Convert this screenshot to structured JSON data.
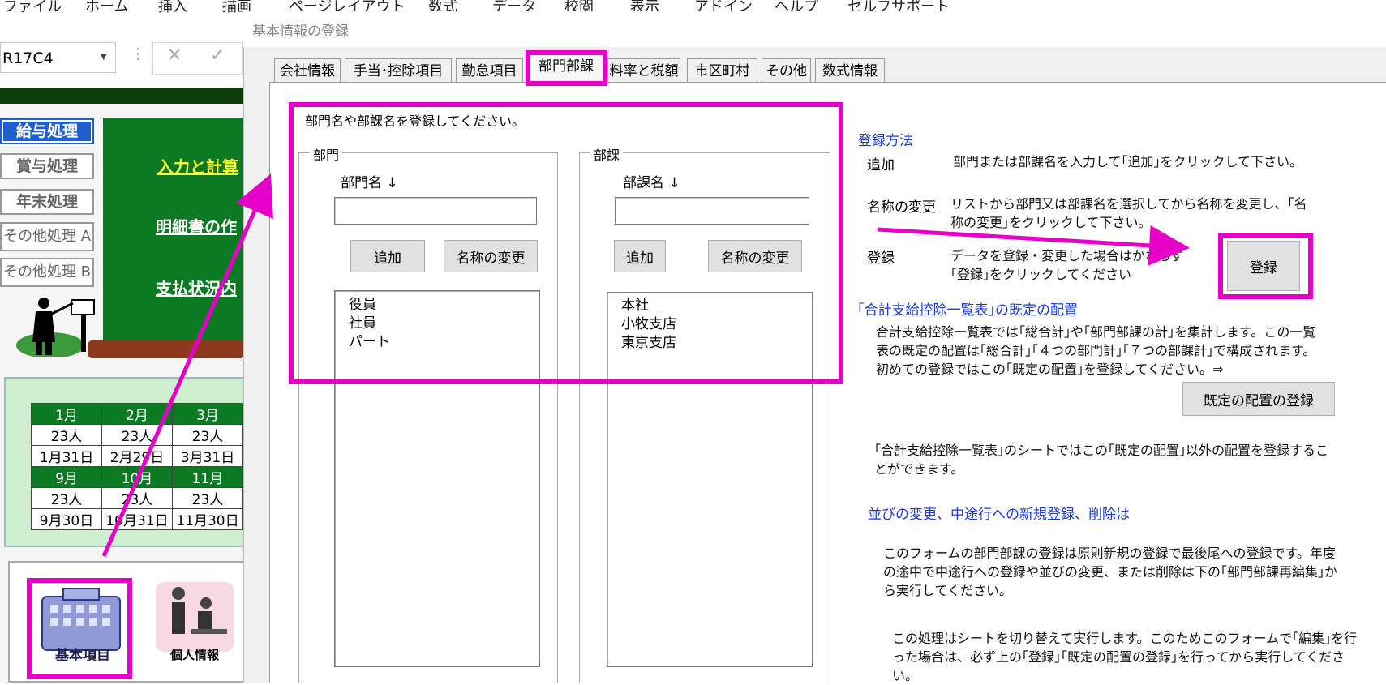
{
  "excel": {
    "menu": [
      "ファイル",
      "ホーム",
      "挿入",
      "描画",
      "ページレイアウト",
      "数式",
      "データ",
      "校閲",
      "表示",
      "アドイン",
      "ヘルプ",
      "セルフサポート"
    ],
    "name_box": "R17C4",
    "side_buttons": [
      "給与処理",
      "賞与処理",
      "年末処理",
      "その他処理 A",
      "その他処理 B"
    ],
    "board_links": [
      "入力と計算",
      "明細書の作",
      "支払状況内"
    ],
    "calendar": {
      "row1_months": [
        "1月",
        "2月",
        "3月"
      ],
      "row1_counts": [
        "23人",
        "23人",
        "23人"
      ],
      "row1_dates": [
        "1月31日",
        "2月29日",
        "3月31日"
      ],
      "row2_months": [
        "9月",
        "10月",
        "11月"
      ],
      "row2_counts": [
        "23人",
        "23人",
        "23人"
      ],
      "row2_dates": [
        "9月30日",
        "10月31日",
        "11月30日"
      ]
    },
    "icons": {
      "kihon_label": "基本項目",
      "kojin_label": "個人情報"
    }
  },
  "dialog": {
    "title": "基本情報の登録",
    "tabs": [
      "会社情報",
      "手当･控除項目",
      "勤怠項目",
      "部門部課",
      "料率と税額",
      "市区町村",
      "その他",
      "数式情報"
    ],
    "active_tab": "部門部課",
    "instruction": "部門名や部課名を登録してください。",
    "dept": {
      "group_caption": "部門",
      "field_label": "部門名 ↓",
      "input_value": "",
      "add_button": "追加",
      "rename_button": "名称の変更",
      "items": [
        "役員",
        "社員",
        "パート"
      ]
    },
    "section": {
      "group_caption": "部課",
      "field_label": "部課名 ↓",
      "input_value": "",
      "add_button": "追加",
      "rename_button": "名称の変更",
      "items": [
        "本社",
        "小牧支店",
        "東京支店"
      ]
    },
    "help": {
      "heading": "登録方法",
      "add_key": "追加",
      "add_text": "部門または部課名を入力して｢追加｣をクリックして下さい。",
      "rename_key": "名称の変更",
      "rename_text": "リストから部門又は部課名を選択してから名称を変更し、｢名称の変更｣をクリックして下さい。",
      "register_key": "登録",
      "register_text": "データを登録・変更した場合はかならず｢登録｣をクリックしてください",
      "register_button": "登録",
      "layout_heading": "｢合計支給控除一覧表｣の既定の配置",
      "layout_text": "合計支給控除一覧表では｢総合計｣や｢部門部課の計｣を集計します。この一覧表の既定の配置は｢総合計｣｢４つの部門計｣｢７つの部課計｣で構成されます。初めての登録ではこの｢既定の配置｣を登録してください。⇒",
      "default_layout_button": "既定の配置の登録",
      "other_layout_text": "｢合計支給控除一覧表｣のシートではこの｢既定の配置｣以外の配置を登録することができます。",
      "reorder_heading": "並びの変更、中途行への新規登録、削除は",
      "reorder_text": "このフォームの部門部課の登録は原則新規の登録で最後尾への登録です。年度の途中で中途行への登録や並びの変更、または削除は下の｢部門部課再編集｣から実行してください。",
      "sheet_switch_text": "この処理はシートを切り替えて実行します。このためこのフォームで｢編集｣を行った場合は、必ず上の｢登録｣｢既定の配置の登録｣を行ってから実行してください。"
    }
  },
  "colors": {
    "highlight": "#e600c8",
    "link_blue": "#1a3cd8",
    "board_green": "#0b7a22"
  }
}
